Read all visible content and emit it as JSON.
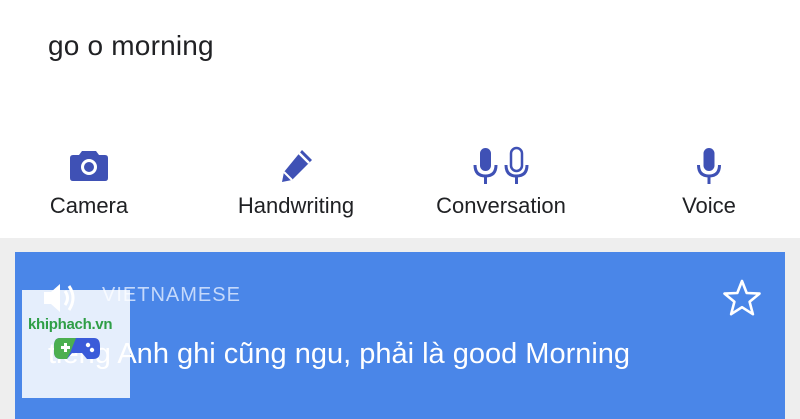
{
  "input": {
    "text": "go o morning"
  },
  "tools": [
    {
      "label": "Camera",
      "icon": "camera-icon"
    },
    {
      "label": "Handwriting",
      "icon": "pen-icon"
    },
    {
      "label": "Conversation",
      "icon": "dual-microphone-icon"
    },
    {
      "label": "Voice",
      "icon": "microphone-icon"
    }
  ],
  "result": {
    "language": "VIETNAMESE",
    "translation": "tiếng Anh ghi cũng ngu, phải là good Morning",
    "speaker_icon": "speaker-icon",
    "star_icon": "star-icon"
  },
  "watermark": {
    "text": "khiphach.vn"
  },
  "colors": {
    "accent": "#3f51b5",
    "card": "#4a86e8",
    "band": "#eeeeee"
  }
}
